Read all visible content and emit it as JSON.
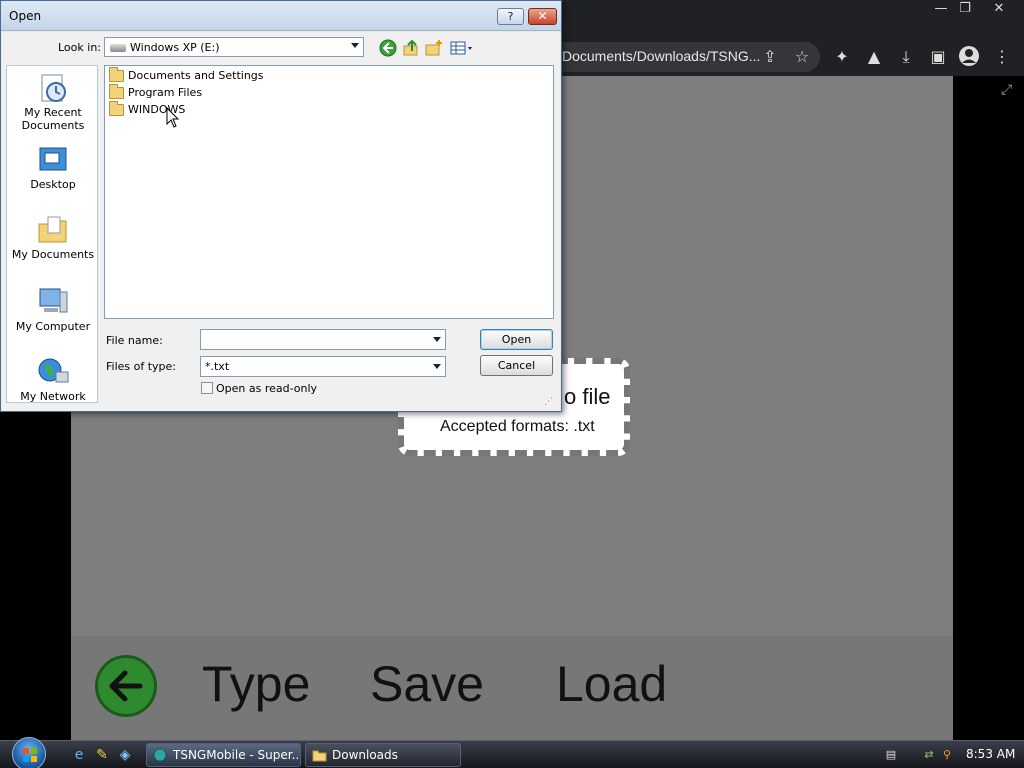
{
  "browser": {
    "address_text": "Documents/Downloads/TSNG...",
    "window_controls": {
      "minimize": "—",
      "restore": "❐",
      "close": "✕"
    }
  },
  "app": {
    "drop_title": "o file",
    "drop_subtitle": "Accepted formats: .txt",
    "buttons": {
      "type": "Type",
      "save": "Save",
      "load": "Load"
    }
  },
  "dialog": {
    "title": "Open",
    "help_label": "?",
    "close_label": "✕",
    "look_in_label": "Look in:",
    "look_in_value": "Windows XP (E:)",
    "places": [
      {
        "label": "My Recent Documents",
        "icon": "recent-documents-icon"
      },
      {
        "label": "Desktop",
        "icon": "desktop-icon"
      },
      {
        "label": "My Documents",
        "icon": "my-documents-icon"
      },
      {
        "label": "My Computer",
        "icon": "my-computer-icon"
      },
      {
        "label": "My Network",
        "icon": "my-network-icon"
      }
    ],
    "files": [
      {
        "name": "Documents and Settings"
      },
      {
        "name": "Program Files"
      },
      {
        "name": "WINDOWS"
      }
    ],
    "file_name_label": "File name:",
    "file_name_value": "",
    "file_type_label": "Files of type:",
    "file_type_value": "*.txt",
    "read_only_label": "Open as read-only",
    "open_button": "Open",
    "cancel_button": "Cancel"
  },
  "taskbar": {
    "tasks": [
      {
        "label": "TSNGMobile - Super..."
      },
      {
        "label": "Downloads"
      }
    ],
    "clock": "8:53 AM"
  },
  "colors": {
    "accent_green": "#2f8a2f",
    "viewport_gray": "#7e7e7e",
    "dialog_face": "#f0f0f0"
  }
}
